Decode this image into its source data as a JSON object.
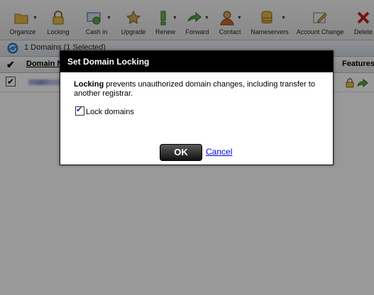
{
  "toolbar": {
    "items": [
      {
        "label": "Organize",
        "icon": "folder-icon",
        "dropdown": true
      },
      {
        "label": "Locking",
        "icon": "lock-icon",
        "dropdown": false
      },
      {
        "label": "Cash in",
        "icon": "cash-in-icon",
        "dropdown": true
      },
      {
        "label": "Upgrade",
        "icon": "upgrade-icon",
        "dropdown": false
      },
      {
        "label": "Renew",
        "icon": "renew-icon",
        "dropdown": true
      },
      {
        "label": "Forward",
        "icon": "forward-icon",
        "dropdown": true
      },
      {
        "label": "Contact",
        "icon": "contact-icon",
        "dropdown": true
      },
      {
        "label": "Nameservers",
        "icon": "nameservers-icon",
        "dropdown": true
      },
      {
        "label": "Account Change",
        "icon": "account-change-icon",
        "dropdown": false
      },
      {
        "label": "Delete",
        "icon": "delete-icon",
        "dropdown": false
      }
    ]
  },
  "status": {
    "count_text": "1 Domains (1 Selected)"
  },
  "grid": {
    "columns": {
      "domain": "Domain N",
      "features": "Features"
    }
  },
  "dialog": {
    "title": "Set Domain Locking",
    "message_bold": "Locking",
    "message_rest": " prevents unauthorized domain changes, including transfer to another registrar.",
    "checkbox_label": "Lock domains",
    "checkbox_checked": true,
    "ok_label": "OK",
    "cancel_label": "Cancel"
  },
  "colors": {
    "dialog_title_bg": "#000000",
    "link": "#0000ee"
  }
}
